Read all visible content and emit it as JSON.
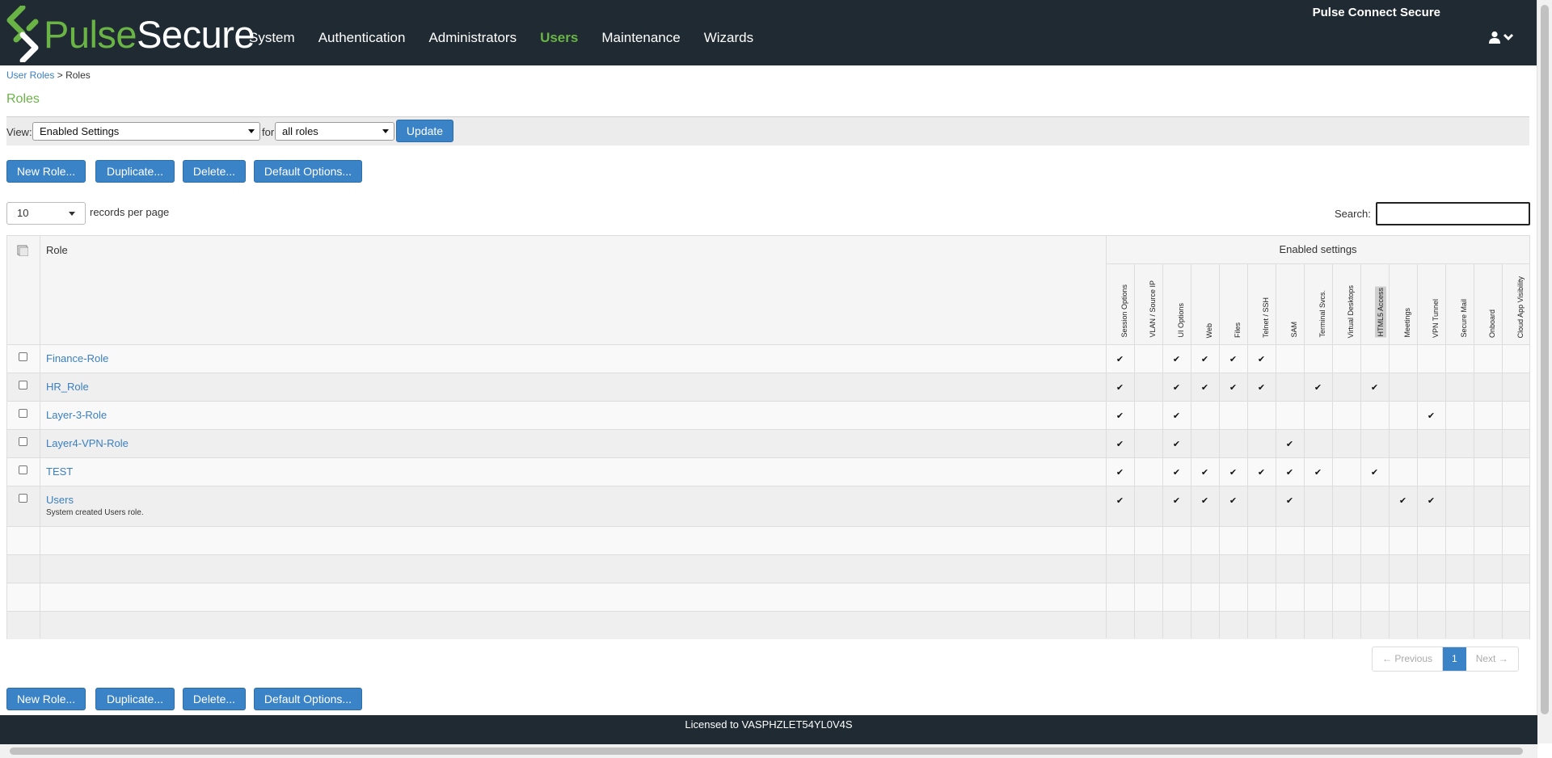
{
  "header": {
    "logo_pulse": "Pulse",
    "logo_secure": "Secure",
    "product_name": "Pulse Connect Secure",
    "nav": [
      "System",
      "Authentication",
      "Administrators",
      "Users",
      "Maintenance",
      "Wizards"
    ],
    "active_nav": "Users",
    "brand_green": "#6ab446",
    "bar_color": "#1f2a33"
  },
  "breadcrumb": {
    "parent": "User Roles",
    "separator": ">",
    "current": "Roles"
  },
  "page_title": "Roles",
  "view_bar": {
    "view_label": "View:",
    "view_selected": "Enabled Settings",
    "for_label": "for",
    "scope_selected": "all roles",
    "update_label": "Update"
  },
  "actions": {
    "new_role": "New Role...",
    "duplicate": "Duplicate...",
    "delete": "Delete...",
    "default_options": "Default Options..."
  },
  "paging": {
    "records_value": "10",
    "records_label": "records per page",
    "search_label": "Search:"
  },
  "table": {
    "role_header": "Role",
    "enabled_header": "Enabled settings",
    "columns": [
      "Session Options",
      "VLAN / Source IP",
      "UI Options",
      "Web",
      "Files",
      "Telnet / SSH",
      "SAM",
      "Terminal Svcs.",
      "Virtual Desktops",
      "HTML5 Access",
      "Meetings",
      "VPN Tunnel",
      "Secure Mail",
      "Onboard",
      "Cloud App Visibility"
    ],
    "sorted_column": "HTML5 Access",
    "tick": "✔",
    "rows": [
      {
        "name": "Finance-Role",
        "desc": "",
        "enabled": [
          1,
          0,
          1,
          1,
          1,
          1,
          0,
          0,
          0,
          0,
          0,
          0,
          0,
          0,
          0
        ]
      },
      {
        "name": "HR_Role",
        "desc": "",
        "enabled": [
          1,
          0,
          1,
          1,
          1,
          1,
          0,
          1,
          0,
          1,
          0,
          0,
          0,
          0,
          0
        ]
      },
      {
        "name": "Layer-3-Role",
        "desc": "",
        "enabled": [
          1,
          0,
          1,
          0,
          0,
          0,
          0,
          0,
          0,
          0,
          0,
          1,
          0,
          0,
          0
        ]
      },
      {
        "name": "Layer4-VPN-Role",
        "desc": "",
        "enabled": [
          1,
          0,
          1,
          0,
          0,
          0,
          1,
          0,
          0,
          0,
          0,
          0,
          0,
          0,
          0
        ]
      },
      {
        "name": "TEST",
        "desc": "",
        "enabled": [
          1,
          0,
          1,
          1,
          1,
          1,
          1,
          1,
          0,
          1,
          0,
          0,
          0,
          0,
          0
        ]
      },
      {
        "name": "Users",
        "desc": "System created Users role.",
        "enabled": [
          1,
          0,
          1,
          1,
          1,
          0,
          1,
          0,
          0,
          0,
          1,
          1,
          0,
          0,
          0
        ]
      }
    ]
  },
  "pagination": {
    "previous": "← Previous",
    "current": "1",
    "next": "Next →"
  },
  "footer": {
    "license": "Licensed to VASPHZLET54YL0V4S"
  }
}
